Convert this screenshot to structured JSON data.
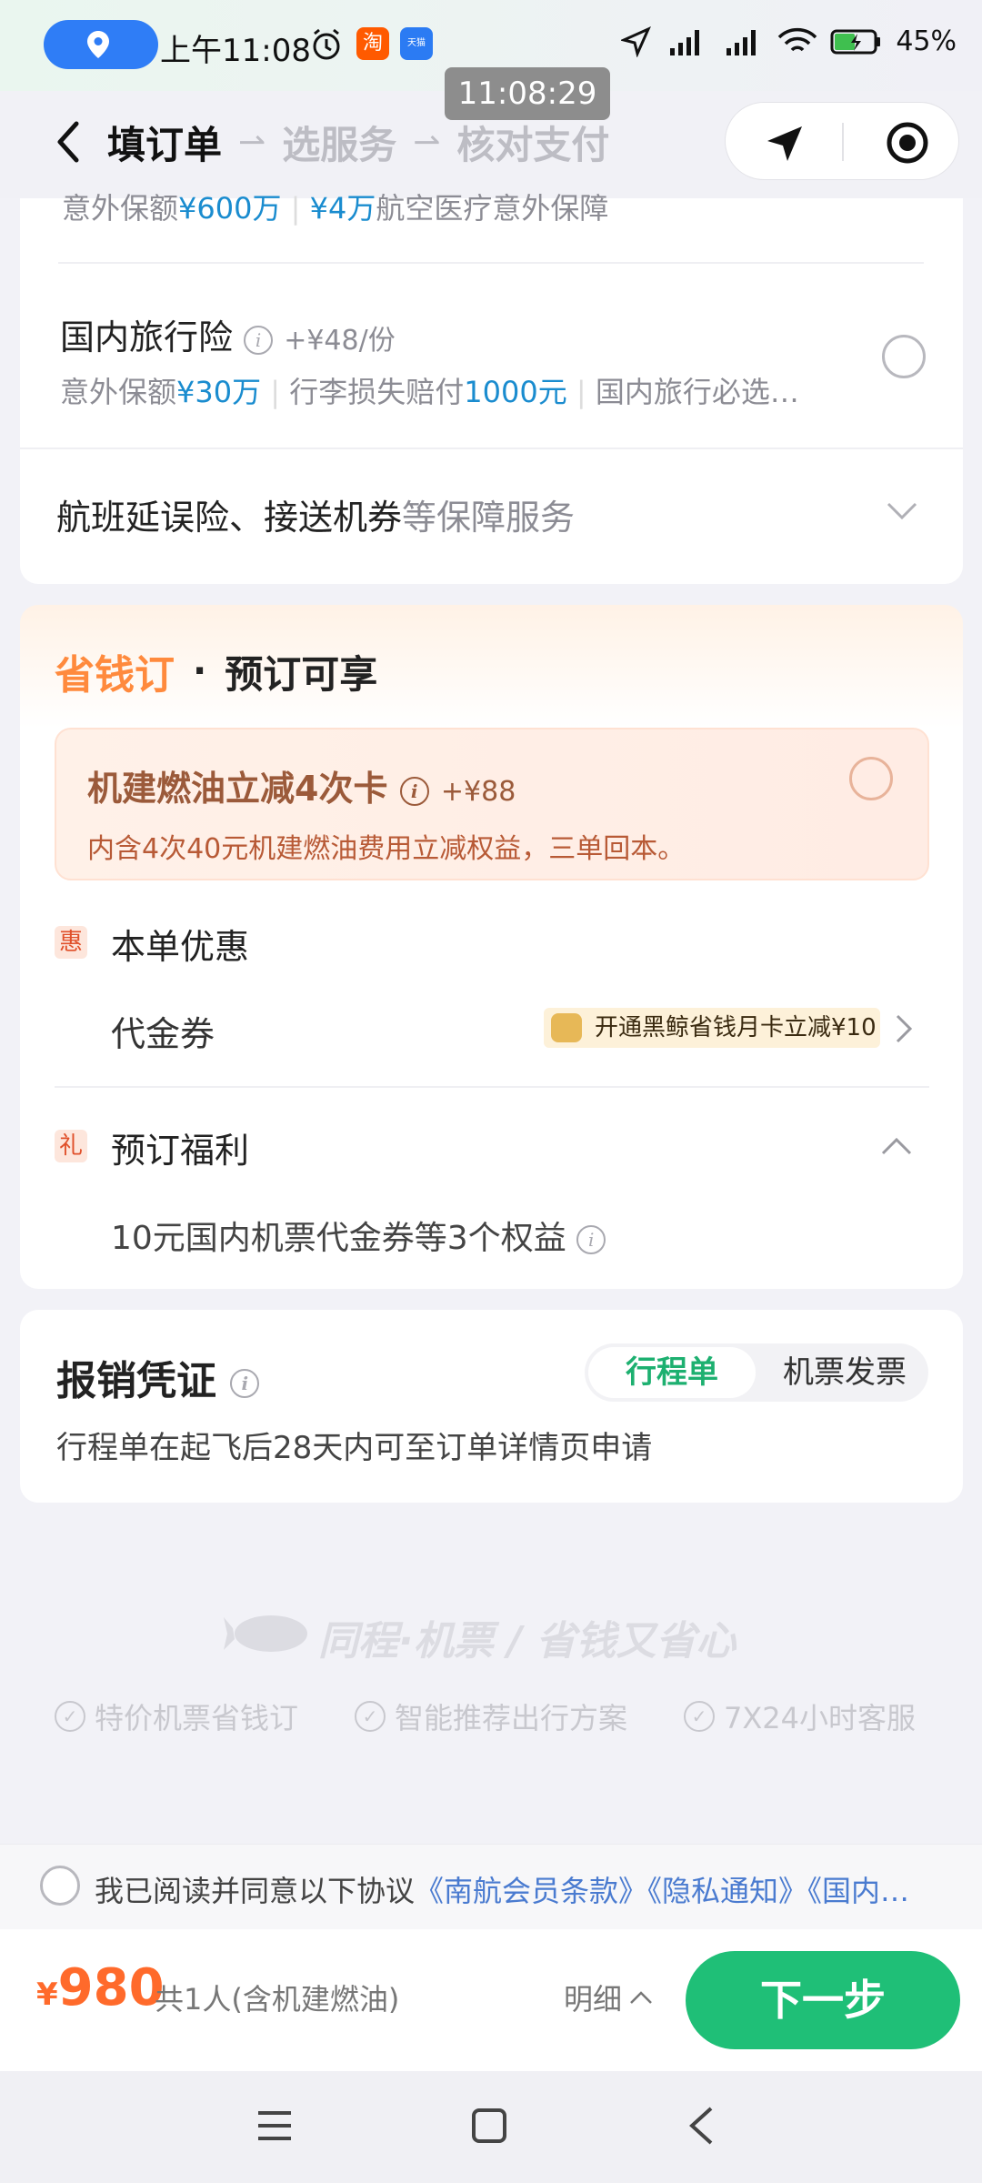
{
  "status_bar": {
    "time": "上午11:08",
    "battery": "45%",
    "clock_overlay": "11:08:29",
    "taobao_glyph": "淘",
    "tianmao_glyph": "天猫"
  },
  "header": {
    "step_active": "填订单",
    "step2": "选服务",
    "step3": "核对支付"
  },
  "insurance": {
    "top_partial": {
      "amount1": "¥600万",
      "amount2": "¥4万",
      "prefix": "意外保额",
      "suffix": "航空医疗意外保障"
    },
    "domestic": {
      "title": "国内旅行险",
      "price": "+¥48/份",
      "desc_prefix": "意外保额",
      "desc_amount1": "¥30万",
      "desc_mid": "行李损失赔付",
      "desc_amount2": "1000元",
      "desc_suffix": "国内旅行必选…"
    },
    "more": {
      "label_main": "航班延误险、接送机券",
      "label_muted": "等保障服务"
    }
  },
  "promo": {
    "brand": "省钱订",
    "dot": "·",
    "title": "预订可享",
    "card": {
      "title": "机建燃油立减4次卡",
      "price": "+¥88",
      "desc": "内含4次40元机建燃油费用立减权益，三单回本。"
    },
    "discount": {
      "tag": "惠",
      "title": "本单优惠",
      "voucher_label": "代金券",
      "vip_text": "开通黑鲸省钱月卡立减¥10"
    },
    "benefit": {
      "tag": "礼",
      "title": "预订福利",
      "desc": "10元国内机票代金券等3个权益"
    }
  },
  "reimburse": {
    "title": "报销凭证",
    "tab_active": "行程单",
    "tab_inactive": "机票发票",
    "desc": "行程单在起飞后28天内可至订单详情页申请"
  },
  "footer_brand": {
    "slogan": "同程·机票 / 省钱又省心",
    "features": [
      "特价机票省钱订",
      "智能推荐出行方案",
      "7X24小时客服"
    ]
  },
  "agreement": {
    "text": "我已阅读并同意以下协议",
    "links": "《南航会员条款》《隐私通知》《国内…"
  },
  "bottom": {
    "currency": "¥",
    "price": "980",
    "note": "共1人(含机建燃油)",
    "detail": "明细",
    "next": "下一步"
  },
  "colors": {
    "brand_green": "#1fbf77",
    "price_orange": "#ff6a2b",
    "link_blue": "#4a7bd0",
    "amount_blue": "#1a8ccf"
  }
}
